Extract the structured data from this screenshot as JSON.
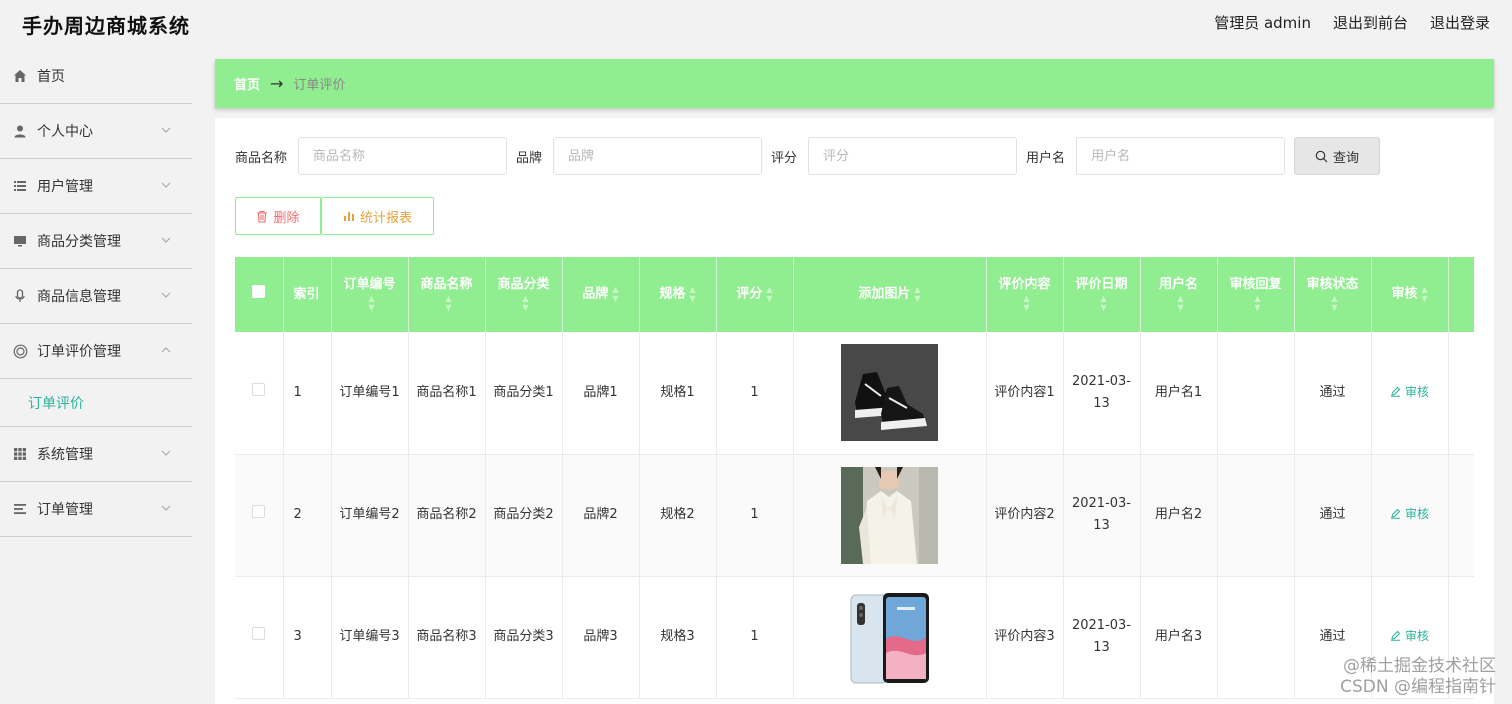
{
  "app": {
    "title": "手办周边商城系统"
  },
  "header": {
    "admin": "管理员 admin",
    "frontend": "退出到前台",
    "logout": "退出登录"
  },
  "sidebar": {
    "items": [
      {
        "label": "首页"
      },
      {
        "label": "个人中心"
      },
      {
        "label": "用户管理"
      },
      {
        "label": "商品分类管理"
      },
      {
        "label": "商品信息管理"
      },
      {
        "label": "订单评价管理"
      },
      {
        "label": "系统管理"
      },
      {
        "label": "订单管理"
      }
    ],
    "sub_item": "订单评价"
  },
  "breadcrumb": {
    "home": "首页",
    "arrow": "→",
    "current": "订单评价"
  },
  "search": {
    "fields": [
      {
        "label": "商品名称",
        "placeholder": "商品名称"
      },
      {
        "label": "品牌",
        "placeholder": "品牌"
      },
      {
        "label": "评分",
        "placeholder": "评分"
      },
      {
        "label": "用户名",
        "placeholder": "用户名"
      }
    ],
    "query": "查询"
  },
  "actions": {
    "delete": "删除",
    "stats": "统计报表"
  },
  "table": {
    "headers": [
      "索引",
      "订单编号",
      "商品名称",
      "商品分类",
      "品牌",
      "规格",
      "评分",
      "添加图片",
      "评价内容",
      "评价日期",
      "用户名",
      "审核回复",
      "审核状态",
      "审核"
    ],
    "rows": [
      {
        "index": "1",
        "order": "订单编号1",
        "name": "商品名称1",
        "category": "商品分类1",
        "brand": "品牌1",
        "spec": "规格1",
        "score": "1",
        "image": "shoe-image",
        "content": "评价内容1",
        "date": "2021-03-13",
        "user": "用户名1",
        "reply": "",
        "status": "通过",
        "action": "审核"
      },
      {
        "index": "2",
        "order": "订单编号2",
        "name": "商品名称2",
        "category": "商品分类2",
        "brand": "品牌2",
        "spec": "规格2",
        "score": "1",
        "image": "blouse-image",
        "content": "评价内容2",
        "date": "2021-03-13",
        "user": "用户名2",
        "reply": "",
        "status": "通过",
        "action": "审核"
      },
      {
        "index": "3",
        "order": "订单编号3",
        "name": "商品名称3",
        "category": "商品分类3",
        "brand": "品牌3",
        "spec": "规格3",
        "score": "1",
        "image": "phone-image",
        "content": "评价内容3",
        "date": "2021-03-13",
        "user": "用户名3",
        "reply": "",
        "status": "通过",
        "action": "审核"
      }
    ]
  },
  "watermark": {
    "line1": "@稀土掘金技术社区",
    "line2": "CSDN @编程指南针"
  },
  "colors": {
    "accent": "#90ee90",
    "link": "#2bb39b",
    "danger": "#f56c6c",
    "warning": "#e6a23c"
  }
}
